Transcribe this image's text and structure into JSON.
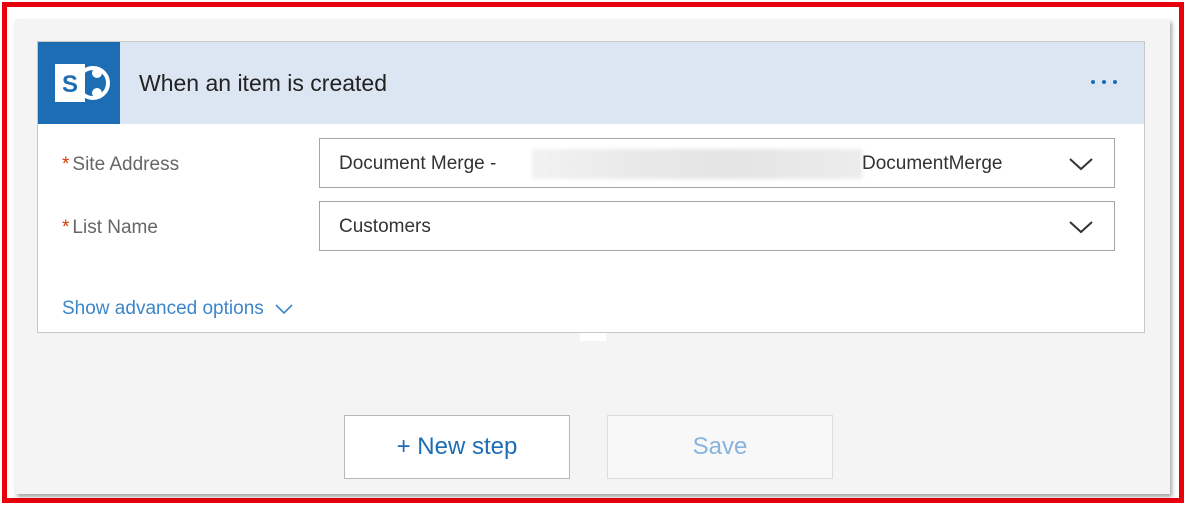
{
  "trigger_card": {
    "title": "When an item is created",
    "icon": "sharepoint-icon",
    "more_icon": "ellipsis-icon"
  },
  "fields": {
    "site_address": {
      "required_marker": "*",
      "label": "Site Address",
      "value_prefix": "Document Merge -",
      "value_suffix": "DocumentMerge"
    },
    "list_name": {
      "required_marker": "*",
      "label": "List Name",
      "value": "Customers"
    }
  },
  "advanced_options": {
    "label": "Show advanced options"
  },
  "buttons": {
    "new_step": "+ New step",
    "save": "Save"
  },
  "colors": {
    "accent": "#1d6db5",
    "header_bg": "#dce6f2",
    "required": "#d83b01",
    "frame": "#e8000b"
  }
}
